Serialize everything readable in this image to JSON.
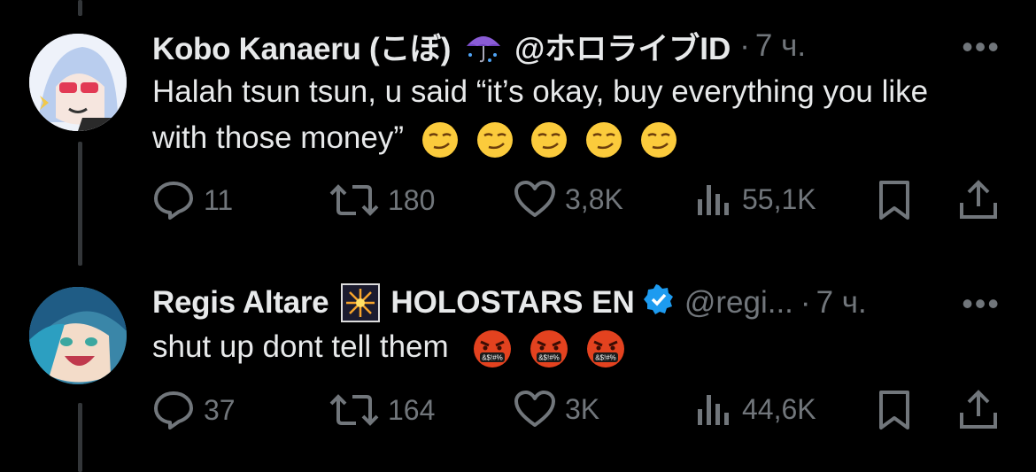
{
  "tweets": [
    {
      "name": "Kobo Kanaeru (こぼ)",
      "name_icon": "umbrella-with-rain-drops-emoji",
      "org": "@ホロライブID",
      "handle": "",
      "separator": "·",
      "time": "7 ч.",
      "text": "Halah tsun tsun, u said “it’s okay, buy everything you like with those money”",
      "text_emojis": [
        "smirking-face",
        "smirking-face",
        "smirking-face",
        "smirking-face",
        "smirking-face"
      ],
      "stats": {
        "replies": "11",
        "reposts": "180",
        "likes": "3,8K",
        "views": "55,1K"
      }
    },
    {
      "name": "Regis Altare",
      "name_icon": "firework-emoji",
      "org": "HOLOSTARS EN",
      "verified": true,
      "handle": "@regi...",
      "separator": "·",
      "time": "7 ч.",
      "text": "shut up dont tell them",
      "text_emojis": [
        "face-with-symbols-on-mouth",
        "face-with-symbols-on-mouth",
        "face-with-symbols-on-mouth"
      ],
      "stats": {
        "replies": "37",
        "reposts": "164",
        "likes": "3K",
        "views": "44,6K"
      }
    }
  ],
  "colors": {
    "background": "#000000",
    "text": "#e7e9ea",
    "muted": "#71767b",
    "verified": "#1d9bf0"
  }
}
